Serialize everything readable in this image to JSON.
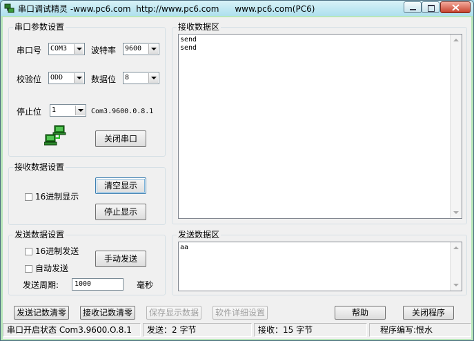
{
  "window": {
    "title": "串口调试精灵 -www.pc6.com  http://www.pc6.com      www.pc6.com(PC6)"
  },
  "port_settings": {
    "title": "串口参数设置",
    "port_label": "串口号",
    "port_value": "COM3",
    "baud_label": "波特率",
    "baud_value": "9600",
    "parity_label": "校验位",
    "parity_value": "ODD",
    "databits_label": "数据位",
    "databits_value": "8",
    "stopbits_label": "停止位",
    "stopbits_value": "1",
    "summary": "Com3.9600.0.8.1",
    "close_port_label": "关闭串口"
  },
  "receive_settings": {
    "title": "接收数据设置",
    "hex_display_label": "16进制显示",
    "clear_display_label": "清空显示",
    "stop_display_label": "停止显示"
  },
  "send_settings": {
    "title": "发送数据设置",
    "hex_send_label": "16进制发送",
    "auto_send_label": "自动发送",
    "manual_send_label": "手动发送",
    "period_label": "发送周期:",
    "period_value": "1000",
    "period_unit": "毫秒"
  },
  "receive_area": {
    "title": "接收数据区",
    "content": "send\nsend"
  },
  "send_area": {
    "title": "发送数据区",
    "content": "aa"
  },
  "bottom_buttons": {
    "clear_send_count": "发送记数清零",
    "clear_recv_count": "接收记数清零",
    "save_display": "保存显示数据",
    "software_details": "软件详细设置",
    "help": "帮助",
    "close_program": "关闭程序"
  },
  "status": {
    "port_state": "串口开启状态  Com3.9600.O.8.1",
    "sent": "发送：2 字节",
    "received": "接收：15 字节",
    "author": "程序编写:恨水"
  }
}
